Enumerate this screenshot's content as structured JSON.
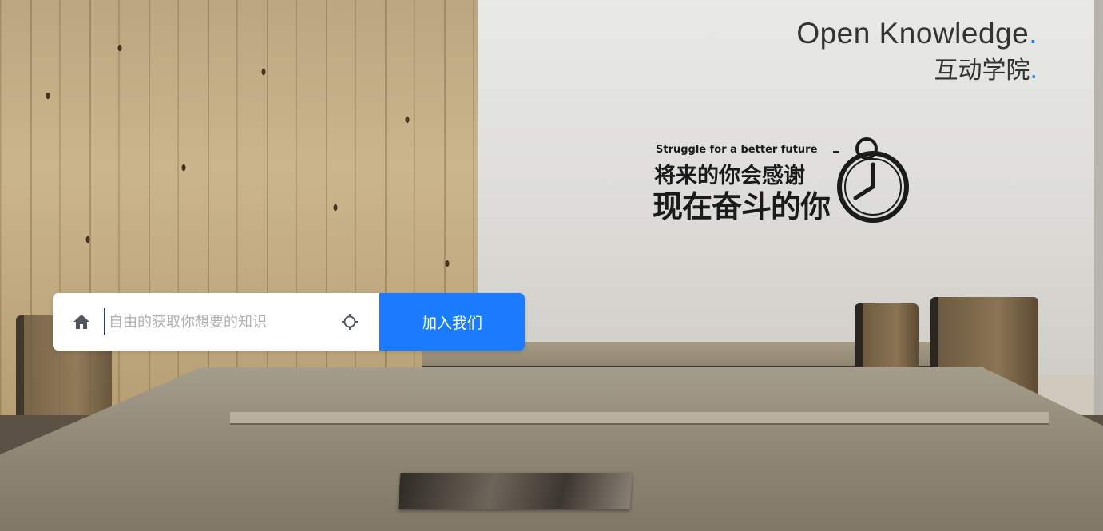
{
  "brand": {
    "title_en": "Open Knowledge",
    "title_zh": "互动学院",
    "accent_dot": ".",
    "accent_color": "#1a7bff"
  },
  "decal": {
    "line_en": "Struggle for a better future",
    "line_zh_1": "将来的你会感谢",
    "line_zh_2": "现在奋斗的你",
    "icon": "stopwatch-icon"
  },
  "search": {
    "icon_left": "home-icon",
    "placeholder": "自由的获取你想要的知识",
    "value": "",
    "icon_right": "crosshair-icon",
    "button_label": "加入我们"
  }
}
